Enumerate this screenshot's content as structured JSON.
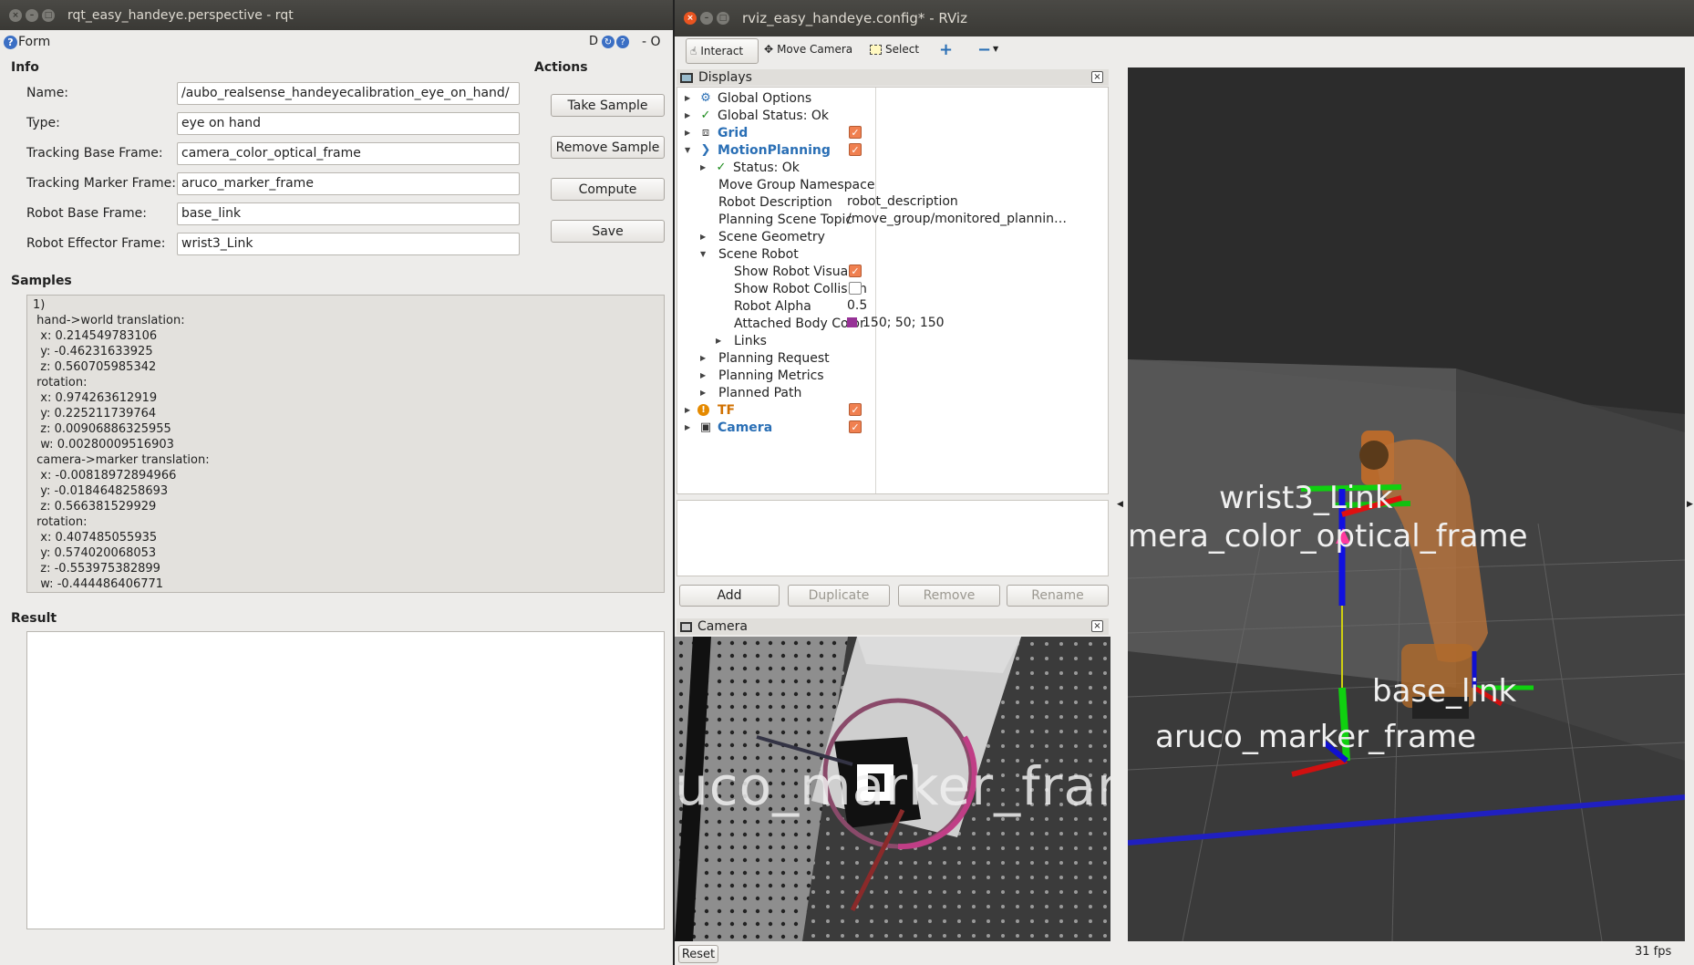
{
  "rqt": {
    "title": "rqt_easy_handeye.perspective - rqt",
    "form_label": "Form",
    "toolbar_glyphs": "D",
    "toolbar_right": "- O",
    "info_header": "Info",
    "actions_header": "Actions",
    "fields": [
      {
        "label": "Name:",
        "value": "/aubo_realsense_handeyecalibration_eye_on_hand/"
      },
      {
        "label": "Type:",
        "value": "eye on hand"
      },
      {
        "label": "Tracking Base Frame:",
        "value": "camera_color_optical_frame"
      },
      {
        "label": "Tracking Marker Frame:",
        "value": "aruco_marker_frame"
      },
      {
        "label": "Robot Base Frame:",
        "value": "base_link"
      },
      {
        "label": "Robot Effector Frame:",
        "value": "wrist3_Link"
      }
    ],
    "actions": [
      "Take Sample",
      "Remove Sample",
      "Compute",
      "Save"
    ],
    "samples_header": "Samples",
    "samples_text": "1)\n hand->world translation:\n  x: 0.214549783106\n  y: -0.46231633925\n  z: 0.560705985342\n rotation:\n  x: 0.974263612919\n  y: 0.225211739764\n  z: 0.00906886325955\n  w: 0.00280009516903\n camera->marker translation:\n  x: -0.00818972894966\n  y: -0.0184648258693\n  z: 0.566381529929\n rotation:\n  x: 0.407485055935\n  y: 0.574020068053\n  z: -0.553975382899\n  w: -0.444486406771",
    "result_header": "Result"
  },
  "rviz": {
    "title": "rviz_easy_handeye.config* - RViz",
    "tools": [
      {
        "label": "Interact",
        "icon": "hand-cursor-icon"
      },
      {
        "label": "Move Camera",
        "icon": "move-camera-icon"
      },
      {
        "label": "Select",
        "icon": "select-box-icon"
      }
    ],
    "displays_title": "Displays",
    "tree": [
      {
        "label": "Global Options",
        "indent": 0,
        "arrow": "▶",
        "icon": "⚙",
        "style": ""
      },
      {
        "label": "Global Status: Ok",
        "indent": 0,
        "arrow": "▶",
        "icon": "✓",
        "style": ""
      },
      {
        "label": "Grid",
        "indent": 0,
        "arrow": "▶",
        "icon": "⧈",
        "style": "blue",
        "check": true
      },
      {
        "label": "MotionPlanning",
        "indent": 0,
        "arrow": "▼",
        "icon": "❯",
        "style": "blue",
        "check": true
      },
      {
        "label": "Status: Ok",
        "indent": 1,
        "arrow": "▶",
        "icon": "✓",
        "style": ""
      },
      {
        "label": "Move Group Namespace",
        "indent": 1,
        "arrow": "",
        "icon": "",
        "style": ""
      },
      {
        "label": "Robot Description",
        "indent": 1,
        "arrow": "",
        "icon": "",
        "style": "",
        "value": "robot_description"
      },
      {
        "label": "Planning Scene Topic",
        "indent": 1,
        "arrow": "",
        "icon": "",
        "style": "",
        "value": "/move_group/monitored_plannin…"
      },
      {
        "label": "Scene Geometry",
        "indent": 1,
        "arrow": "▶",
        "icon": "",
        "style": ""
      },
      {
        "label": "Scene Robot",
        "indent": 1,
        "arrow": "▼",
        "icon": "",
        "style": ""
      },
      {
        "label": "Show Robot Visual",
        "indent": 2,
        "arrow": "",
        "icon": "",
        "style": "",
        "check": true
      },
      {
        "label": "Show Robot Collision",
        "indent": 2,
        "arrow": "",
        "icon": "",
        "style": "",
        "check": false
      },
      {
        "label": "Robot Alpha",
        "indent": 2,
        "arrow": "",
        "icon": "",
        "style": "",
        "value": "0.5"
      },
      {
        "label": "Attached Body Color",
        "indent": 2,
        "arrow": "",
        "icon": "",
        "style": "",
        "value": "150; 50; 150",
        "swatch": "#963296"
      },
      {
        "label": "Links",
        "indent": 2,
        "arrow": "▶",
        "icon": "",
        "style": ""
      },
      {
        "label": "Planning Request",
        "indent": 1,
        "arrow": "▶",
        "icon": "",
        "style": ""
      },
      {
        "label": "Planning Metrics",
        "indent": 1,
        "arrow": "▶",
        "icon": "",
        "style": ""
      },
      {
        "label": "Planned Path",
        "indent": 1,
        "arrow": "▶",
        "icon": "",
        "style": ""
      },
      {
        "label": "TF",
        "indent": 0,
        "arrow": "▶",
        "icon": "!",
        "style": "orange",
        "check": true
      },
      {
        "label": "Camera",
        "indent": 0,
        "arrow": "▶",
        "icon": "▣",
        "style": "blue",
        "check": true
      }
    ],
    "display_buttons": [
      {
        "label": "Add",
        "enabled": true
      },
      {
        "label": "Duplicate",
        "enabled": false
      },
      {
        "label": "Remove",
        "enabled": false
      },
      {
        "label": "Rename",
        "enabled": false
      }
    ],
    "camera_title": "Camera",
    "camera_overlay": "uco_marker_fran",
    "viewport_labels": {
      "wrist": "wrist3_Link",
      "camera_frame": "mera_color_optical_frame",
      "base": "base_link",
      "aruco": "aruco_marker_frame"
    },
    "reset_label": "Reset",
    "fps": "31 fps"
  }
}
